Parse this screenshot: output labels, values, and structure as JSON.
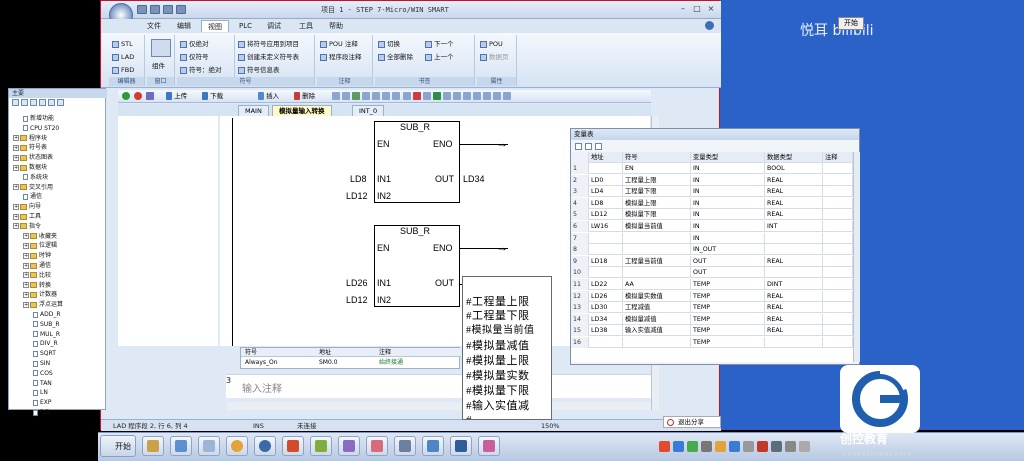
{
  "window": {
    "title": "项目 1 - STEP 7-Micro/WIN SMART"
  },
  "menu": [
    "文件",
    "编辑",
    "视图",
    "PLC",
    "调试",
    "工具",
    "帮助"
  ],
  "menu_active": "视图",
  "ribbon": {
    "editor_group": {
      "label": "编辑器",
      "items": [
        "STL",
        "LAD",
        "FBD"
      ]
    },
    "component_group": {
      "label": "窗口",
      "items": [
        "组件"
      ]
    },
    "symbol_group": {
      "label": "符号",
      "items": [
        "仅绝对",
        "仅符号",
        "符号：绝对"
      ]
    },
    "symbol_group2": {
      "items": [
        "将符号应用到项目",
        "创建未定义符号表",
        "符号信息表"
      ]
    },
    "comment_group": {
      "label": "注释",
      "items": [
        "POU 注释",
        "程序段注释"
      ]
    },
    "bookmark_group": {
      "label": "书签",
      "items": [
        "切换",
        "全部删除",
        "下一个",
        "上一个"
      ]
    },
    "props_group": {
      "label": "属性",
      "items": [
        "POU",
        "数据页"
      ]
    }
  },
  "tree": {
    "title": "主要",
    "nodes": [
      {
        "label": "新增功能",
        "indent": 1,
        "type": "leaf"
      },
      {
        "label": "CPU ST20",
        "indent": 1,
        "type": "leaf"
      },
      {
        "label": "程序块",
        "indent": 0,
        "type": "folder"
      },
      {
        "label": "符号表",
        "indent": 0,
        "type": "folder"
      },
      {
        "label": "状态图表",
        "indent": 0,
        "type": "folder"
      },
      {
        "label": "数据块",
        "indent": 0,
        "type": "folder"
      },
      {
        "label": "系统块",
        "indent": 1,
        "type": "leaf"
      },
      {
        "label": "交叉引用",
        "indent": 0,
        "type": "folder"
      },
      {
        "label": "通信",
        "indent": 1,
        "type": "leaf"
      },
      {
        "label": "向导",
        "indent": 0,
        "type": "folder"
      },
      {
        "label": "工具",
        "indent": 0,
        "type": "folder"
      },
      {
        "label": "指令",
        "indent": 0,
        "type": "folder"
      },
      {
        "label": "收藏夹",
        "indent": 1,
        "type": "folder"
      },
      {
        "label": "位逻辑",
        "indent": 1,
        "type": "folder"
      },
      {
        "label": "时钟",
        "indent": 1,
        "type": "folder"
      },
      {
        "label": "通信",
        "indent": 1,
        "type": "folder"
      },
      {
        "label": "比较",
        "indent": 1,
        "type": "folder"
      },
      {
        "label": "转换",
        "indent": 1,
        "type": "folder"
      },
      {
        "label": "计数器",
        "indent": 1,
        "type": "folder"
      },
      {
        "label": "浮点运算",
        "indent": 1,
        "type": "folder"
      },
      {
        "label": "ADD_R",
        "indent": 2,
        "type": "leaf"
      },
      {
        "label": "SUB_R",
        "indent": 2,
        "type": "leaf"
      },
      {
        "label": "MUL_R",
        "indent": 2,
        "type": "leaf"
      },
      {
        "label": "DIV_R",
        "indent": 2,
        "type": "leaf"
      },
      {
        "label": "SQRT",
        "indent": 2,
        "type": "leaf"
      },
      {
        "label": "SIN",
        "indent": 2,
        "type": "leaf"
      },
      {
        "label": "COS",
        "indent": 2,
        "type": "leaf"
      },
      {
        "label": "TAN",
        "indent": 2,
        "type": "leaf"
      },
      {
        "label": "LN",
        "indent": 2,
        "type": "leaf"
      },
      {
        "label": "EXP",
        "indent": 2,
        "type": "leaf"
      },
      {
        "label": "PID",
        "indent": 2,
        "type": "leaf"
      }
    ]
  },
  "editor_toolbar": {
    "upload": "上传",
    "download": "下载",
    "insert": "插入",
    "delete": "删除"
  },
  "tabs": [
    "MAIN",
    "模拟量输入转换",
    "INT_0"
  ],
  "active_tab": "模拟量输入转换",
  "ladder": {
    "block1": {
      "name": "SUB_R",
      "en": "EN",
      "eno": "ENO",
      "in1_label": "IN1",
      "in2_label": "IN2",
      "out_label": "OUT",
      "in1": "LD8",
      "in2": "LD12",
      "out": "LD34"
    },
    "block2": {
      "name": "SUB_R",
      "en": "EN",
      "eno": "ENO",
      "in1_label": "IN1",
      "in2_label": "IN2",
      "out_label": "OUT",
      "in1": "LD26",
      "in2": "LD12"
    }
  },
  "autocomplete": [
    "#工程量上限",
    "#工程量下限",
    "#模拟量当前值",
    "#模拟量减值",
    "#模拟量上限",
    "#模拟量实数",
    "#模拟量下限",
    "#输入实值减",
    "#..."
  ],
  "symbol_strip": {
    "headers": [
      "符号",
      "地址",
      "注释"
    ],
    "row": [
      "Always_On",
      "SM0.0",
      "始终接通"
    ]
  },
  "note": {
    "line": "3",
    "placeholder": "输入注释"
  },
  "var_table": {
    "title": "变量表",
    "headers": [
      "",
      "地址",
      "符号",
      "变量类型",
      "数据类型",
      "注释"
    ],
    "rows": [
      [
        "1",
        "",
        "EN",
        "IN",
        "BOOL",
        ""
      ],
      [
        "2",
        "LD0",
        "工程量上限",
        "IN",
        "REAL",
        ""
      ],
      [
        "3",
        "LD4",
        "工程量下限",
        "IN",
        "REAL",
        ""
      ],
      [
        "4",
        "LD8",
        "模拟量上限",
        "IN",
        "REAL",
        ""
      ],
      [
        "5",
        "LD12",
        "模拟量下限",
        "IN",
        "REAL",
        ""
      ],
      [
        "6",
        "LW16",
        "模拟量当前值",
        "IN",
        "INT",
        ""
      ],
      [
        "7",
        "",
        "",
        "IN",
        "",
        ""
      ],
      [
        "8",
        "",
        "",
        "IN_OUT",
        "",
        ""
      ],
      [
        "9",
        "LD18",
        "工程量当前值",
        "OUT",
        "REAL",
        ""
      ],
      [
        "10",
        "",
        "",
        "OUT",
        "",
        ""
      ],
      [
        "11",
        "LD22",
        "AA",
        "TEMP",
        "DINT",
        ""
      ],
      [
        "12",
        "LD26",
        "模拟量实数值",
        "TEMP",
        "REAL",
        ""
      ],
      [
        "13",
        "LD30",
        "工程减值",
        "TEMP",
        "REAL",
        ""
      ],
      [
        "14",
        "LD34",
        "模拟量减值",
        "TEMP",
        "REAL",
        ""
      ],
      [
        "15",
        "LD38",
        "输入实值减值",
        "TEMP",
        "REAL",
        ""
      ],
      [
        "16",
        "",
        "",
        "TEMP",
        "",
        ""
      ]
    ]
  },
  "status": {
    "position": "LAD 程序段 2, 行 6, 列 4",
    "mode": "INS",
    "connection": "未连接",
    "zoom": "150%"
  },
  "exit_share": "退出分享",
  "taskbar": {
    "start": "开始"
  },
  "overlay": {
    "bili": "悦耳",
    "pause": "开始",
    "brand": "创控教育",
    "brand_sub": "CHUANGKONGJIAOYU"
  },
  "colors": {
    "title_red": "#c8102e",
    "ribbon_blue": "#dbe6f4",
    "desk_blue": "#2a62c8"
  }
}
